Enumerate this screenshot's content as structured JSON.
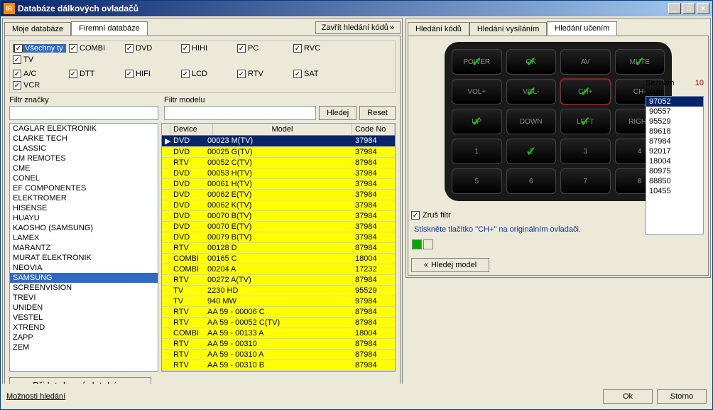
{
  "window": {
    "title": "Databáze dálkových ovladačů"
  },
  "left": {
    "tabs": {
      "mine": "Moje databáze",
      "firm": "Firemní databáze",
      "close": "Zavřít hledání kódů"
    },
    "types": {
      "row1": [
        "Všechny ty",
        "COMBI",
        "DVD",
        "HIHI",
        "PC",
        "RVC",
        "TV"
      ],
      "row2": [
        "A/C",
        "DTT",
        "HIFI",
        "LCD",
        "RTV",
        "SAT",
        "VCR"
      ]
    },
    "filters": {
      "brand_label": "Filtr značky",
      "model_label": "Filtr modelu",
      "search": "Hledej",
      "reset": "Reset"
    },
    "brands": [
      "CAGLAR ELEKTRONIK",
      "CLARKE TECH",
      "CLASSIC",
      "CM REMOTES",
      "CME",
      "CONEL",
      "EF COMPONENTES",
      "ELEKTROMER",
      "HISENSE",
      "HUAYU",
      "KAOSHO (SAMSUNG)",
      "LAMEX",
      "MARANTZ",
      "MURAT ELEKTRONIK",
      "NEOVIA",
      "SAMSUNG",
      "SCREENVISION",
      "TREVI",
      "UNIDEN",
      "VESTEL",
      "XTREND",
      "ZAPP",
      "ZEM"
    ],
    "brand_selected": 15,
    "cols": {
      "dev": "Device",
      "model": "Model",
      "code": "Code No"
    },
    "rows": [
      {
        "dev": "DVD",
        "model": "00023 M(TV)",
        "code": "37984",
        "sel": true
      },
      {
        "dev": "DVD",
        "model": "00025 G(TV)",
        "code": "37984"
      },
      {
        "dev": "RTV",
        "model": "00052 C(TV)",
        "code": "87984"
      },
      {
        "dev": "DVD",
        "model": "00053 H(TV)",
        "code": "37984"
      },
      {
        "dev": "DVD",
        "model": "00061 H(TV)",
        "code": "37984"
      },
      {
        "dev": "DVD",
        "model": "00062 E(TV)",
        "code": "37984"
      },
      {
        "dev": "DVD",
        "model": "00062 K(TV)",
        "code": "37984"
      },
      {
        "dev": "DVD",
        "model": "00070 B(TV)",
        "code": "37984"
      },
      {
        "dev": "DVD",
        "model": "00070 E(TV)",
        "code": "37984"
      },
      {
        "dev": "DVD",
        "model": "00079 B(TV)",
        "code": "37984"
      },
      {
        "dev": "RTV",
        "model": "00128 D",
        "code": "87984"
      },
      {
        "dev": "COMBI",
        "model": "00165 C",
        "code": "18004"
      },
      {
        "dev": "COMBI",
        "model": "00204 A",
        "code": "17232"
      },
      {
        "dev": "RTV",
        "model": "00272 A(TV)",
        "code": "87984"
      },
      {
        "dev": "TV",
        "model": "2230 HD",
        "code": "95529"
      },
      {
        "dev": "TV",
        "model": "940 MW",
        "code": "97984"
      },
      {
        "dev": "RTV",
        "model": "AA 59 - 00006 C",
        "code": "87984"
      },
      {
        "dev": "RTV",
        "model": "AA 59 - 00052 C(TV)",
        "code": "87984"
      },
      {
        "dev": "COMBI",
        "model": "AA 59 - 00133 A",
        "code": "18004"
      },
      {
        "dev": "RTV",
        "model": "AA 59 - 00310",
        "code": "87984"
      },
      {
        "dev": "RTV",
        "model": "AA 59 - 00310 A",
        "code": "87984"
      },
      {
        "dev": "RTV",
        "model": "AA 59 - 00310 B",
        "code": "87984"
      }
    ],
    "add_btn": "Přidat do mé databáze"
  },
  "right": {
    "tabs": {
      "code": "Hledání kódů",
      "tx": "Hledání vysíláním",
      "learn": "Hledání učením"
    },
    "remote": [
      {
        "t": "POWER",
        "g": true
      },
      {
        "t": "OK",
        "g": true
      },
      {
        "t": "AV"
      },
      {
        "t": "MUTE",
        "g": true
      },
      {
        "t": "VOL+"
      },
      {
        "t": "VOL-",
        "g": true
      },
      {
        "t": "CH+",
        "g": true,
        "r": true
      },
      {
        "t": "CH-"
      },
      {
        "t": "UP",
        "g": true
      },
      {
        "t": "DOWN"
      },
      {
        "t": "LEFT",
        "g": true
      },
      {
        "t": "RIGHT"
      },
      {
        "t": "1"
      },
      {
        "t": "2",
        "g": true
      },
      {
        "t": "3"
      },
      {
        "t": "4"
      },
      {
        "t": "5"
      },
      {
        "t": "6"
      },
      {
        "t": "7"
      },
      {
        "t": "8"
      }
    ],
    "codes": {
      "label": "Seznam kódů:",
      "count": "10",
      "list": [
        "97052",
        "90557",
        "95529",
        "89618",
        "87984",
        "92017",
        "18004",
        "80975",
        "88850",
        "10455"
      ],
      "selected": 0
    },
    "cancel_filter": "Zruš filtr",
    "instruction": "Stiskněte tlačítko \"CH+\" na originálním ovladači.",
    "search_model": "Hledej model"
  },
  "bottom": {
    "options": "Možnosti hledání",
    "ok": "Ok",
    "cancel": "Storno"
  }
}
